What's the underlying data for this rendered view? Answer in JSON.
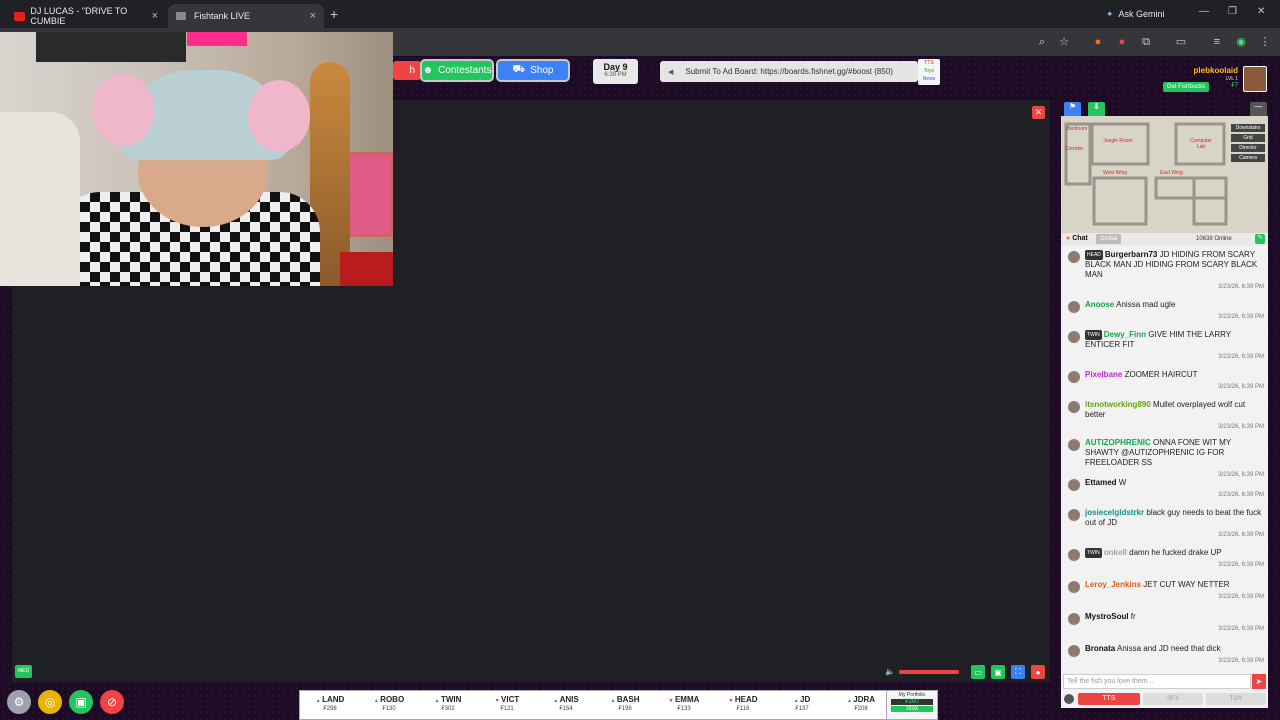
{
  "browser": {
    "tabs": [
      {
        "title": "DJ LUCAS - \"DRIVE TO CUMBIE",
        "close": "×"
      },
      {
        "title": "Fishtank LIVE",
        "close": "×"
      }
    ],
    "new_tab": "+",
    "ask_gemini": "Ask Gemini",
    "window_controls": [
      "—",
      "❐",
      "✕"
    ]
  },
  "topbar": {
    "partial_button": "h",
    "contestants_label": "Contestants",
    "shop_label": "Shop",
    "day_label": "Day 9",
    "day_time": "6:39 PM",
    "ad_board_text": "Submit To Ad Board: https://boards.fishnet.gg/#boost (850)",
    "mini_tags": [
      "TTS",
      "Toys",
      "News"
    ]
  },
  "user": {
    "username": "plebkoolaid",
    "level": "LVL 1",
    "currency": "₣7",
    "get_fishbucks": "Get Fishbucks"
  },
  "map": {
    "rooms": [
      "Jungle Room",
      "Computer Lab",
      "Corridor",
      "West Wing",
      "East Wing",
      "Bedroom"
    ],
    "views": [
      "Downstairs",
      "Grid",
      "Director",
      "Camera"
    ]
  },
  "chat": {
    "label": "Chat",
    "global_tab": "Global",
    "online": "10638 Online",
    "input_placeholder": "Tell the fish you love them...",
    "tts_label": "TTS",
    "sfx_label": "SFX",
    "toy_label": "TOY",
    "messages": [
      {
        "badge": "HEAD",
        "user": "Burgerbarn73",
        "color": "#111111",
        "text": "JD HIDING FROM SCARY BLACK MAN JD HIDING FROM SCARY BLACK MAN",
        "time": "3/23/26, 6:39 PM"
      },
      {
        "badge": "",
        "user": "Anoose",
        "color": "#16a34a",
        "text": "Anissa mad ugle",
        "time": "3/23/26, 6:39 PM"
      },
      {
        "badge": "TWIN",
        "user": "Dewy_Finn",
        "color": "#16a34a",
        "text": "GIVE HIM THE LARRY ENTICER FIT",
        "time": "3/23/26, 6:39 PM"
      },
      {
        "badge": "",
        "user": "Pixelbane",
        "color": "#c026d3",
        "text": "ZOOMER HAIRCUT",
        "time": "3/23/26, 6:39 PM"
      },
      {
        "badge": "",
        "user": "itsnotworking890",
        "color": "#65a30d",
        "text": "Mullet overplayed wolf cut better",
        "time": "3/23/26, 6:39 PM"
      },
      {
        "badge": "",
        "user": "AUTIZOPHRENIC",
        "color": "#16a34a",
        "text": "ONNA FONE WIT MY SHAWTY @AUTIZOPHRENIC IG FOR FREELOADER SS",
        "time": "3/23/26, 6:39 PM"
      },
      {
        "badge": "",
        "user": "Ettamed",
        "color": "#111111",
        "text": "W",
        "time": "3/23/26, 6:39 PM"
      },
      {
        "badge": "",
        "user": "josiecelgldstrkr",
        "color": "#0d9488",
        "text": "black guy needs to beat the fuck out of JD",
        "time": "3/23/26, 6:39 PM"
      },
      {
        "badge": "TWIN",
        "user": "onkell",
        "color": "#9ca3af",
        "text": "damn he fucked drake UP",
        "time": "3/23/26, 6:39 PM"
      },
      {
        "badge": "",
        "user": "Leroy_Jenkins",
        "color": "#ea580c",
        "text": "JET CUT WAY NETTER",
        "time": "3/23/26, 6:39 PM"
      },
      {
        "badge": "",
        "user": "MystroSoul",
        "color": "#111111",
        "text": "fr",
        "time": "3/23/26, 6:39 PM"
      },
      {
        "badge": "",
        "user": "Bronata",
        "color": "#111111",
        "text": "Anissa and JD need that dick",
        "time": "3/23/26, 6:39 PM"
      }
    ]
  },
  "ticker": [
    {
      "name": "LAND",
      "price": "₣298",
      "dir": "up"
    },
    {
      "name": "ROBO",
      "price": "₣130",
      "dir": "up"
    },
    {
      "name": "TWIN",
      "price": "₣302",
      "dir": "up"
    },
    {
      "name": "VICT",
      "price": "₣121",
      "dir": "down"
    },
    {
      "name": "ANIS",
      "price": "₣154",
      "dir": "up"
    },
    {
      "name": "BASH",
      "price": "₣198",
      "dir": "up"
    },
    {
      "name": "EMMA",
      "price": "₣133",
      "dir": "down"
    },
    {
      "name": "HEAD",
      "price": "₣116",
      "dir": "down"
    },
    {
      "name": "JD",
      "price": "₣137",
      "dir": "up"
    },
    {
      "name": "JDRA",
      "price": "₣208",
      "dir": "up"
    }
  ],
  "portfolio": {
    "label": "My Portfolio",
    "value": "₣260",
    "action": "Stox"
  },
  "med_badge": "MED",
  "colors": {
    "accent_green": "#22c55e",
    "accent_blue": "#3b82f6",
    "bg_purple": "#1d0a24"
  }
}
